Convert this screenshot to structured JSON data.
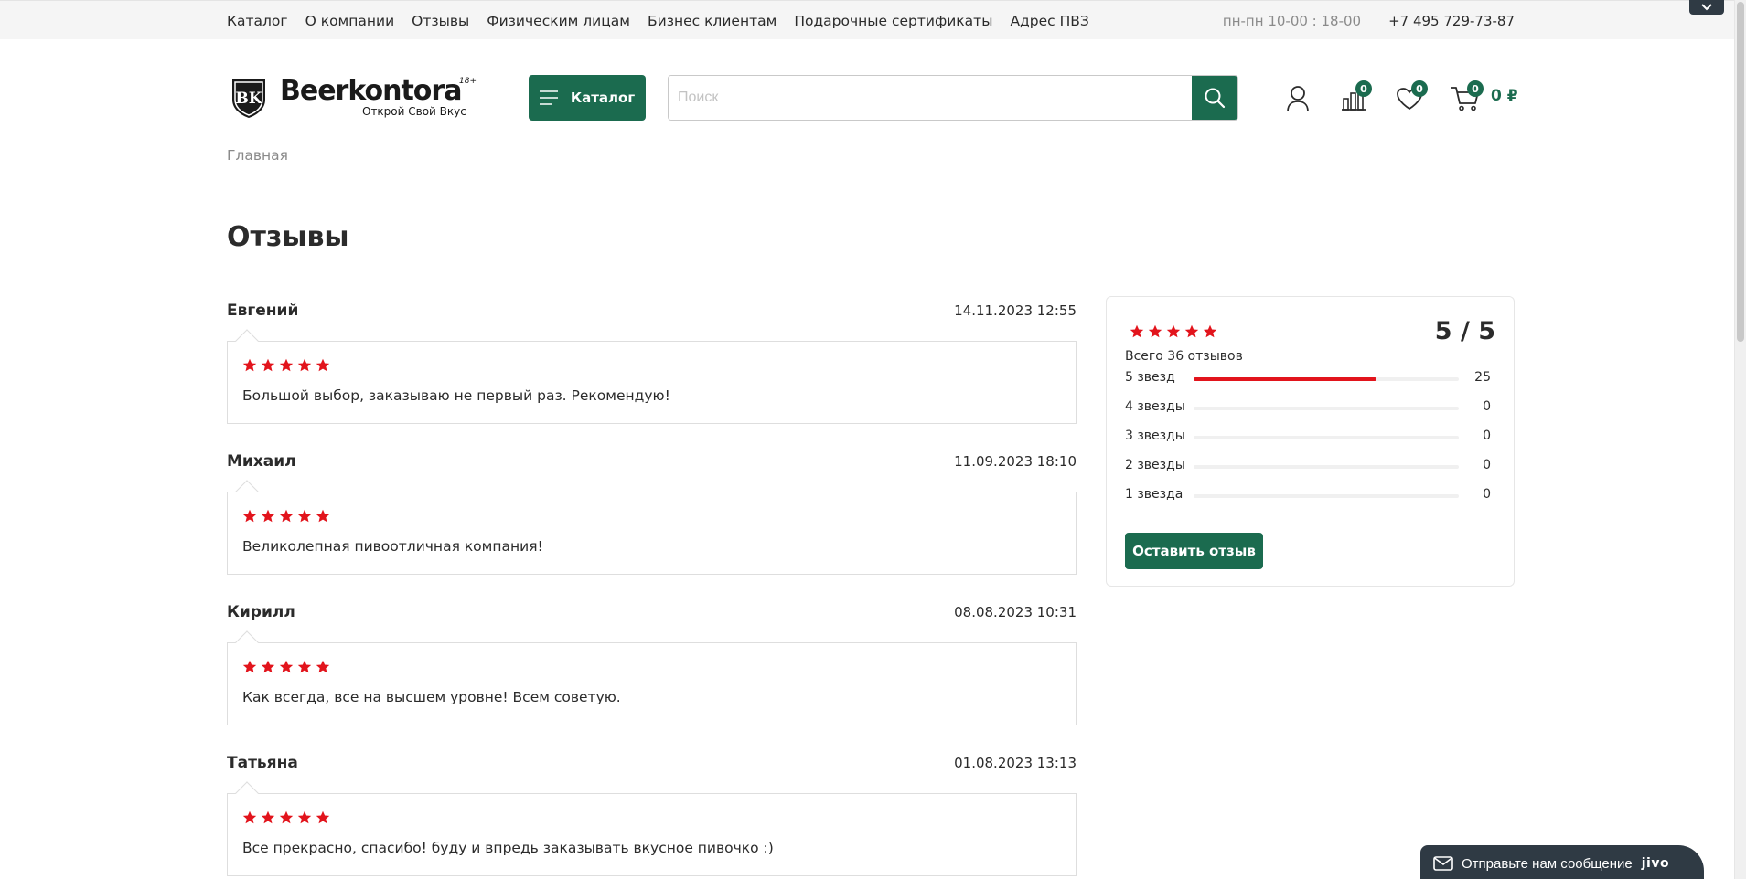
{
  "topnav": {
    "items": [
      "Каталог",
      "О компании",
      "Отзывы",
      "Физическим лицам",
      "Бизнес клиентам",
      "Подарочные сертификаты",
      "Адрес ПВЗ"
    ],
    "hours": "пн-пн 10-00 : 18-00",
    "phone": "+7 495 729-73-87"
  },
  "header": {
    "logo_brand": "Beerkontora",
    "logo_age": "18+",
    "logo_tagline": "Открой Свой Вкус",
    "catalog_label": "Каталог",
    "search_placeholder": "Поиск",
    "compare_count": "0",
    "favorites_count": "0",
    "cart_count": "0",
    "cart_sum": "0 ₽"
  },
  "breadcrumb": "Главная",
  "page_title": "Отзывы",
  "reviews": [
    {
      "name": "Евгений",
      "date": "14.11.2023 12:55",
      "rating": 5,
      "text": "Большой выбор, заказываю не первый раз. Рекомендую!"
    },
    {
      "name": "Михаил",
      "date": "11.09.2023 18:10",
      "rating": 5,
      "text": "Великолепная пивоотличная компания!"
    },
    {
      "name": "Кирилл",
      "date": "08.08.2023 10:31",
      "rating": 5,
      "text": "Как всегда, все на высшем уровне! Всем советую."
    },
    {
      "name": "Татьяна",
      "date": "01.08.2023 13:13",
      "rating": 5,
      "text": "Все прекрасно, спасибо! буду и впредь заказывать вкусное пивочко :)"
    }
  ],
  "summary": {
    "score": "5 / 5",
    "total": "Всего 36 отзывов",
    "rows": [
      {
        "label": "5 звезд",
        "count": "25",
        "fraction": 0.69
      },
      {
        "label": "4 звезды",
        "count": "0",
        "fraction": 0
      },
      {
        "label": "3 звезды",
        "count": "0",
        "fraction": 0
      },
      {
        "label": "2 звезды",
        "count": "0",
        "fraction": 0
      },
      {
        "label": "1 звезда",
        "count": "0",
        "fraction": 0
      }
    ],
    "leave_review_label": "Оставить отзыв"
  },
  "chat": {
    "label": "Отправьте нам сообщение",
    "brand": "jivo"
  },
  "colors": {
    "accent": "#1b6b4f",
    "star": "#e2141c",
    "dark": "#2f3a44"
  }
}
